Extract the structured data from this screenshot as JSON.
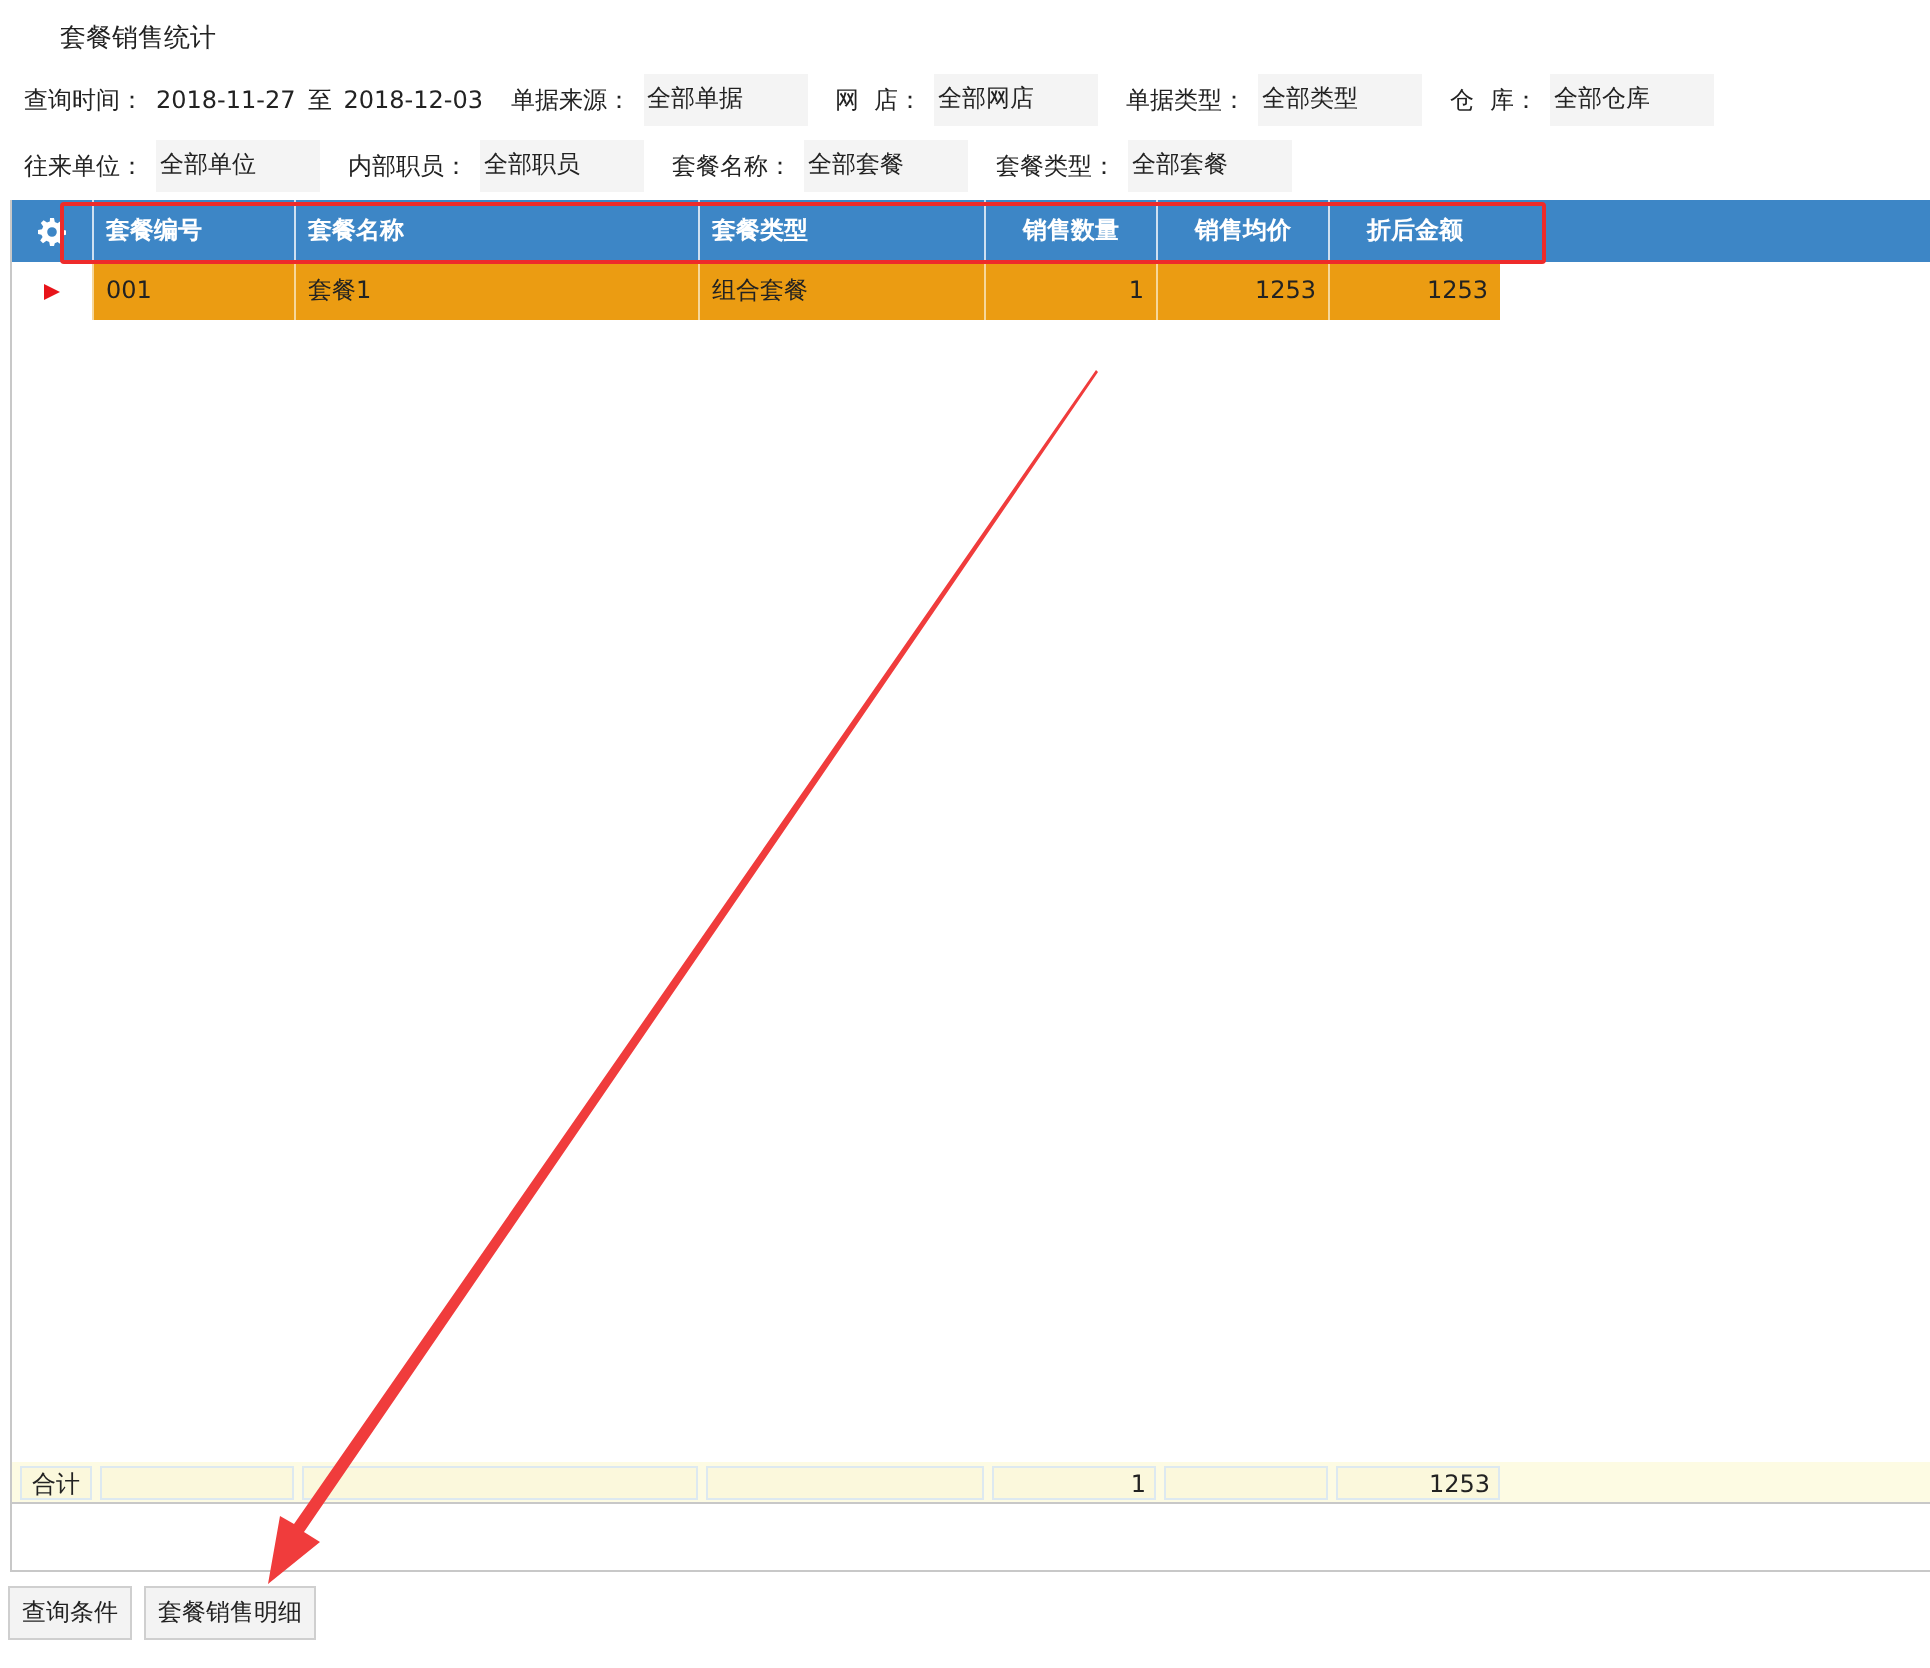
{
  "title": "套餐销售统计",
  "filters": [
    [
      {
        "kind": "range",
        "label": "查询时间：",
        "from": "2018-11-27",
        "sep": "至",
        "to": "2018-12-03"
      },
      {
        "kind": "select",
        "label": "单据来源：",
        "value": "全部单据"
      },
      {
        "kind": "select",
        "label": "网  店：",
        "value": "全部网店"
      },
      {
        "kind": "select",
        "label": "单据类型：",
        "value": "全部类型"
      },
      {
        "kind": "select",
        "label": "仓  库：",
        "value": "全部仓库"
      }
    ],
    [
      {
        "kind": "select",
        "label": "往来单位：",
        "value": "全部单位"
      },
      {
        "kind": "select",
        "label": "内部职员：",
        "value": "全部职员"
      },
      {
        "kind": "select",
        "label": "套餐名称：",
        "value": "全部套餐"
      },
      {
        "kind": "select",
        "label": "套餐类型：",
        "value": "全部套餐"
      }
    ]
  ],
  "table": {
    "columns": [
      {
        "label": "套餐编号",
        "numeric": false
      },
      {
        "label": "套餐名称",
        "numeric": false
      },
      {
        "label": "套餐类型",
        "numeric": false
      },
      {
        "label": "销售数量",
        "numeric": true,
        "total": "1"
      },
      {
        "label": "销售均价",
        "numeric": true
      },
      {
        "label": "折后金额",
        "numeric": true,
        "total": "1253"
      }
    ],
    "rows": [
      {
        "selected": true,
        "cells": [
          "001",
          "套餐1",
          "组合套餐",
          "1",
          "1253",
          "1253"
        ]
      }
    ],
    "footer_label": "合计"
  },
  "buttons": [
    "查询条件",
    "套餐销售明细"
  ]
}
